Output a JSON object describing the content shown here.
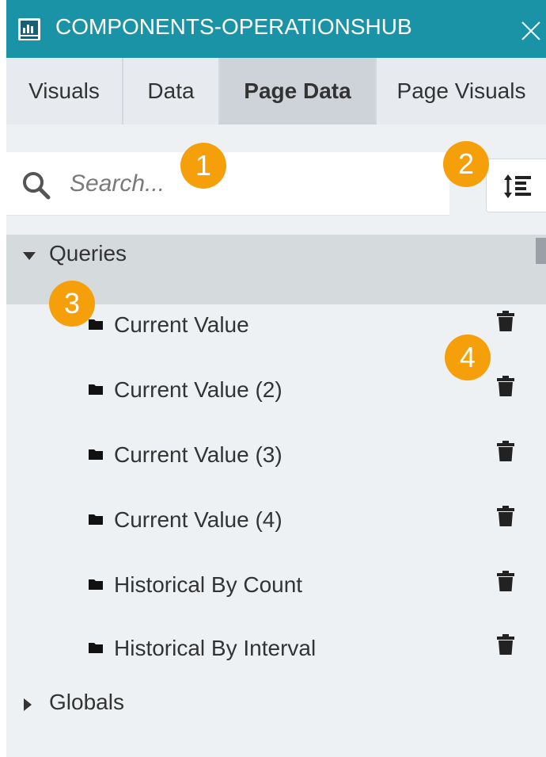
{
  "window": {
    "title": "COMPONENTS-OPERATIONSHUB",
    "app_icon": "dashboard-icon",
    "close_icon": "close-icon"
  },
  "tabs": [
    {
      "label": "Visuals",
      "active": false
    },
    {
      "label": "Data",
      "active": false
    },
    {
      "label": "Page Data",
      "active": true
    },
    {
      "label": "Page Visuals",
      "active": false
    }
  ],
  "search": {
    "placeholder": "Search...",
    "value": "",
    "icon": "search-icon"
  },
  "sort_button": {
    "icon": "sort-icon"
  },
  "tree": {
    "queries_label": "Queries",
    "queries_expanded": true,
    "items": [
      {
        "label": "Current Value"
      },
      {
        "label": "Current Value (2)"
      },
      {
        "label": "Current Value (3)"
      },
      {
        "label": "Current Value (4)"
      },
      {
        "label": "Historical By Count"
      },
      {
        "label": "Historical By Interval"
      }
    ],
    "globals_label": "Globals",
    "globals_expanded": false
  },
  "callouts": [
    "1",
    "2",
    "3",
    "4"
  ],
  "colors": {
    "titlebar": "#1a93a6",
    "badge": "#f5a00a",
    "active_tab": "#cdd3d8",
    "panel_bg": "#eef1f3"
  }
}
